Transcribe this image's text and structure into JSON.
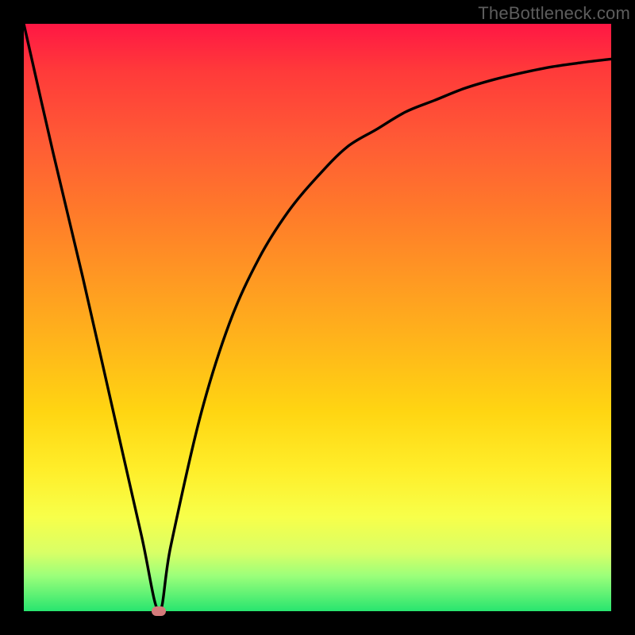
{
  "watermark": "TheBottleneck.com",
  "chart_data": {
    "type": "line",
    "title": "",
    "xlabel": "",
    "ylabel": "",
    "xlim": [
      0,
      100
    ],
    "ylim": [
      0,
      100
    ],
    "grid": false,
    "legend": false,
    "minimum_point": {
      "x": 23,
      "y": 0
    },
    "series": [
      {
        "name": "bottleneck-curve",
        "x": [
          0,
          5,
          10,
          15,
          20,
          23,
          25,
          30,
          35,
          40,
          45,
          50,
          55,
          60,
          65,
          70,
          75,
          80,
          85,
          90,
          95,
          100
        ],
        "y": [
          100,
          78,
          57,
          35,
          13,
          0,
          11,
          33,
          49,
          60,
          68,
          74,
          79,
          82,
          85,
          87,
          89,
          90.5,
          91.7,
          92.7,
          93.4,
          94
        ]
      }
    ],
    "marker": {
      "x": 23,
      "y": 0,
      "color": "#d47b7b"
    },
    "background_gradient": {
      "direction": "vertical",
      "stops": [
        {
          "pos": 0.0,
          "color": "#ff1744"
        },
        {
          "pos": 0.32,
          "color": "#ff7a2a"
        },
        {
          "pos": 0.66,
          "color": "#ffd512"
        },
        {
          "pos": 0.9,
          "color": "#d9ff66"
        },
        {
          "pos": 1.0,
          "color": "#28e56f"
        }
      ]
    }
  }
}
